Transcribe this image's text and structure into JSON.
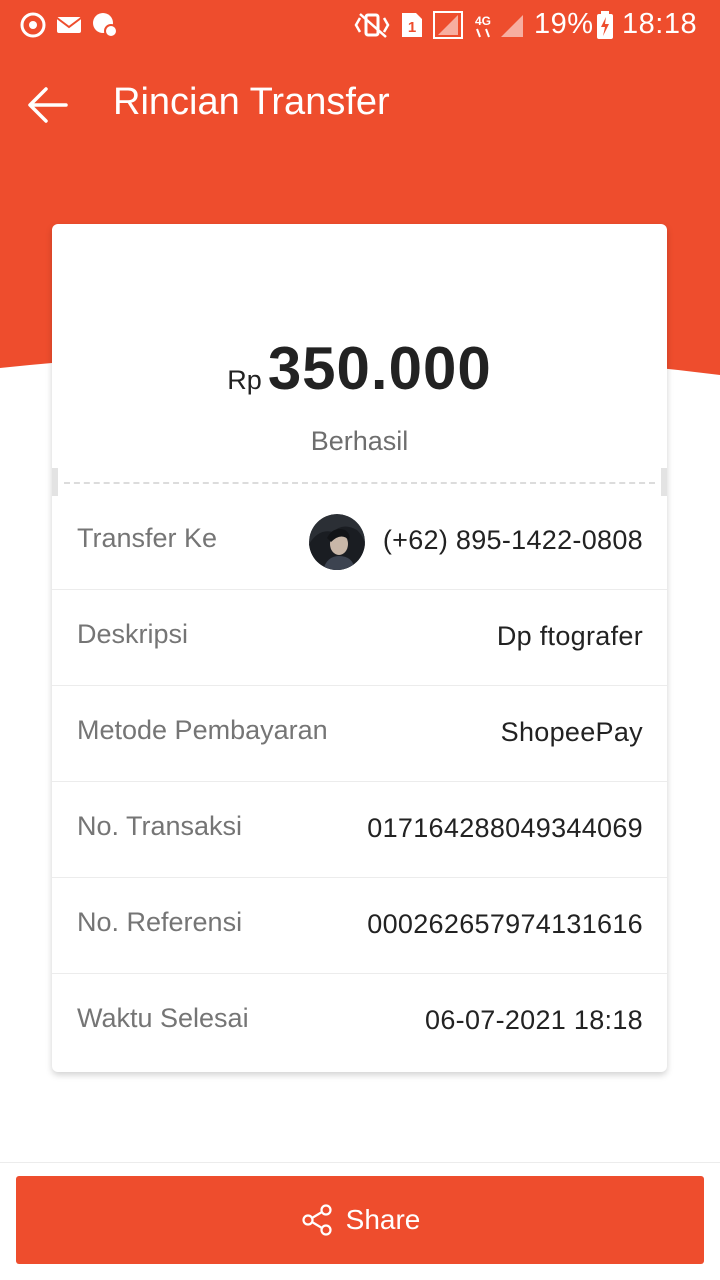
{
  "colors": {
    "brand": "#ee4d2d",
    "status_bar_icon": "#ffffff"
  },
  "status_bar": {
    "left_icons": [
      "sync-icon",
      "mail-icon",
      "messenger-icon"
    ],
    "right_icons": [
      "vibrate-icon",
      "sim-icon",
      "signal-icon",
      "4g-icon",
      "signal-icon",
      "battery-charging-icon"
    ],
    "battery": "19%",
    "time": "18:18"
  },
  "header": {
    "title": "Rincian Transfer",
    "back_icon": "arrow-left-icon"
  },
  "summary": {
    "currency": "Rp",
    "amount": "350.000",
    "status": "Berhasil"
  },
  "details": [
    {
      "label": "Transfer Ke",
      "value": "(+62) 895-1422-0808",
      "has_avatar": true
    },
    {
      "label": "Deskripsi",
      "value": "Dp ftografer"
    },
    {
      "label": "Metode Pembayaran",
      "value": "ShopeePay"
    },
    {
      "label": "No. Transaksi",
      "value": "017164288049344069"
    },
    {
      "label": "No. Referensi",
      "value": "000262657974131616"
    },
    {
      "label": "Waktu Selesai",
      "value": "06-07-2021 18:18"
    }
  ],
  "footer": {
    "share_label": "Share",
    "share_icon": "share-icon"
  }
}
